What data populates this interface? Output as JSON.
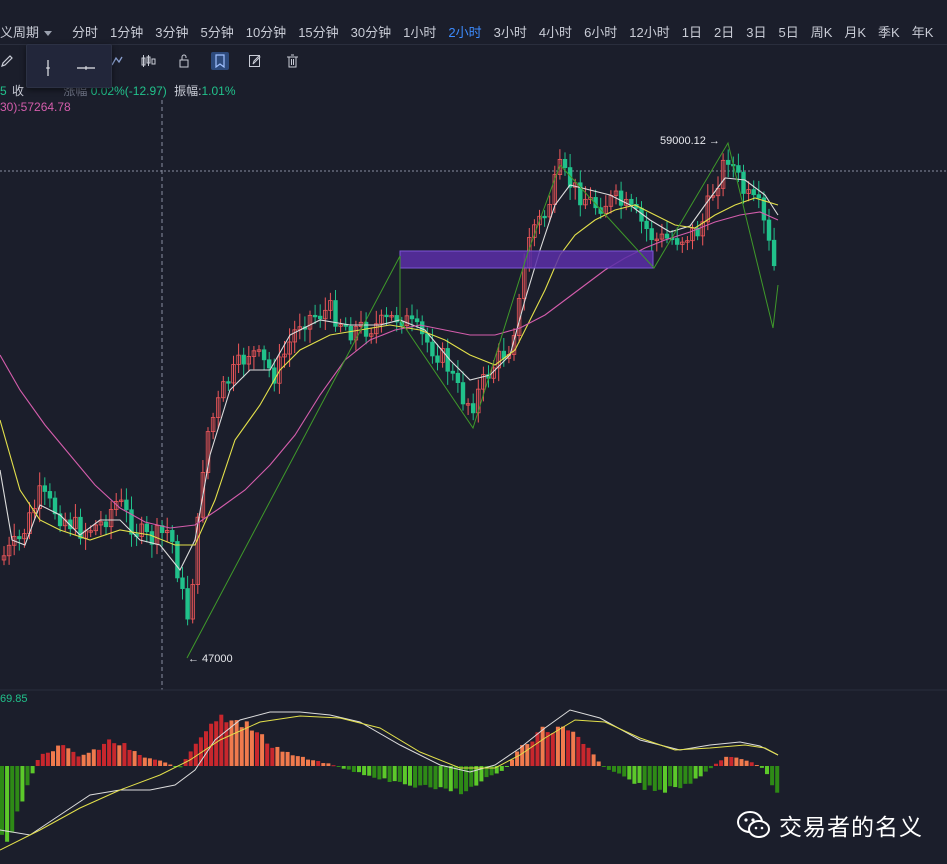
{
  "topbar": {
    "period_label": "义周期",
    "tabs": [
      "分时",
      "1分钟",
      "3分钟",
      "5分钟",
      "10分钟",
      "15分钟",
      "30分钟",
      "1小时",
      "2小时",
      "3小时",
      "4小时",
      "6小时",
      "12小时",
      "1日",
      "2日",
      "3日",
      "5日",
      "周K",
      "月K",
      "季K",
      "年K"
    ],
    "active_tab": "2小时"
  },
  "toolbar": {
    "icons": [
      "pencil-icon",
      "measure-icon",
      "candle-icon",
      "lock-icon",
      "bookmark-icon",
      "edit-icon",
      "trash-icon"
    ]
  },
  "popover": {
    "icons": [
      "vertical-line-icon",
      "horizontal-line-icon"
    ]
  },
  "info": {
    "close_frag": "5",
    "close_label": "收",
    "change_frag": "涨幅",
    "change_value": "0.02%(-12.97)",
    "amplitude_label": "振幅:",
    "amplitude_value": "1.01%",
    "ma_label": "30):57264.78"
  },
  "annotations": {
    "high": "59000.12 →",
    "low": "← 47000"
  },
  "macd": {
    "value": "69.85"
  },
  "colors": {
    "background": "#1b1e2b",
    "up": "#f0575a",
    "down": "#21c18b",
    "active_tab": "#3d8bfd",
    "ma_white": "#dcdcdc",
    "ma_yellow": "#e3e04b",
    "ma_pink": "#d45dac",
    "zigzag": "#3f9a2a",
    "rectangle": "#5a2fa8"
  },
  "watermark": {
    "text": "交易者的名义"
  }
}
